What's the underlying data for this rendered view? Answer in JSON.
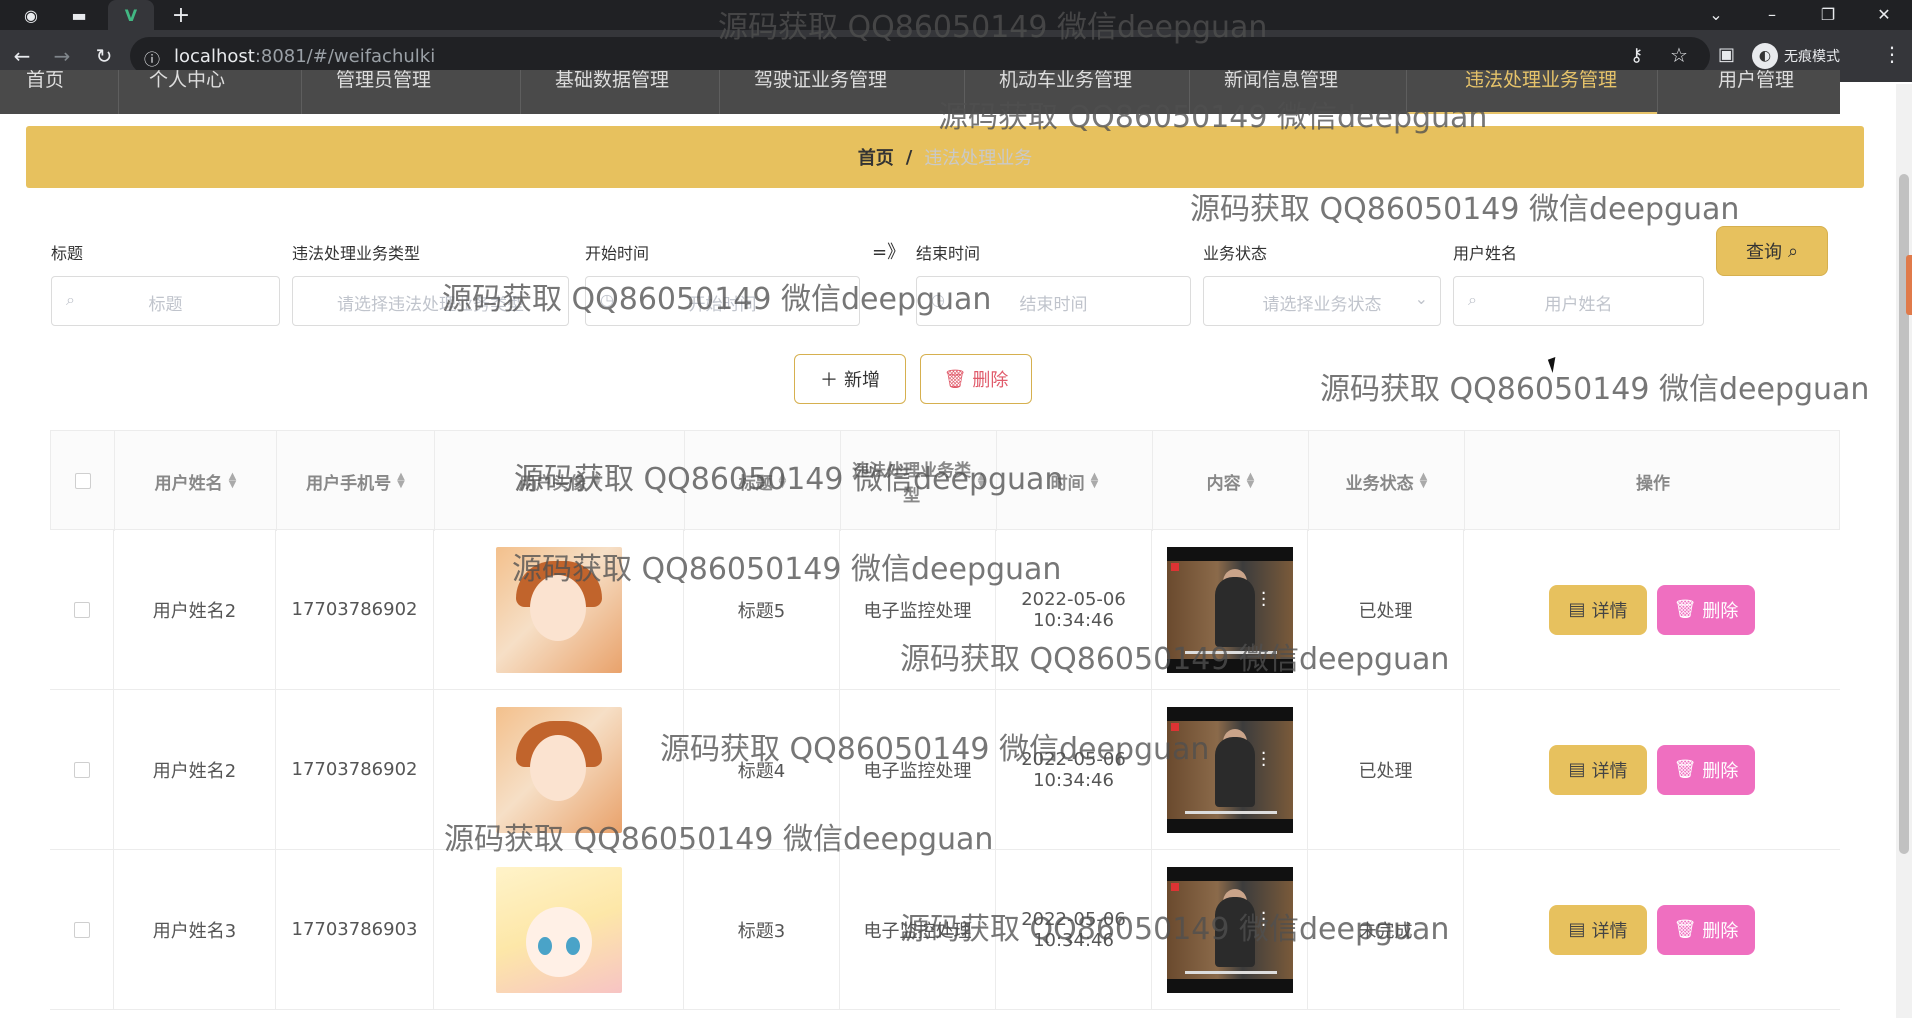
{
  "browser": {
    "url_host": "localhost",
    "url_rest": ":8081/#/weifachulki",
    "incognito_label": "无痕模式"
  },
  "menu": {
    "items": [
      {
        "label": "首页"
      },
      {
        "label": "个人中心"
      },
      {
        "label": "管理员管理"
      },
      {
        "label": "基础数据管理"
      },
      {
        "label": "驾驶证业务管理"
      },
      {
        "label": "机动车业务管理"
      },
      {
        "label": "新闻信息管理"
      },
      {
        "label": "违法处理业务管理"
      },
      {
        "label": "用户管理"
      }
    ]
  },
  "breadcrumb": {
    "home": "首页",
    "separator": "/",
    "current": "违法处理业务"
  },
  "filters": {
    "title_label": "标题",
    "title_placeholder": "标题",
    "type_label": "违法处理业务类型",
    "type_placeholder": "请选择违法处理业务类型",
    "start_label": "开始时间",
    "start_placeholder": "开始时间",
    "range_sep": "=》",
    "end_label": "结束时间",
    "end_placeholder": "结束时间",
    "status_label": "业务状态",
    "status_placeholder": "请选择业务状态",
    "user_label": "用户姓名",
    "user_placeholder": "用户姓名",
    "query_button": "查询"
  },
  "actions": {
    "add": "新增",
    "delete": "删除"
  },
  "table": {
    "columns": [
      "用户姓名",
      "用户手机号",
      "用户头像",
      "标题",
      "违法处理业务类型",
      "时间",
      "内容",
      "业务状态",
      "操作"
    ],
    "rows": [
      {
        "user": "用户姓名2",
        "phone": "17703786902",
        "title": "标题5",
        "type": "电子监控处理",
        "time": "2022-05-06 10:34:46",
        "status": "已处理"
      },
      {
        "user": "用户姓名2",
        "phone": "17703786902",
        "title": "标题4",
        "type": "电子监控处理",
        "time": "2022-05-06 10:34:46",
        "status": "已处理"
      },
      {
        "user": "用户姓名3",
        "phone": "17703786903",
        "title": "标题3",
        "type": "电子监控处理",
        "time": "2022-05-06 10:34:46",
        "status": "未完成"
      }
    ],
    "detail_button": "详情",
    "delete_button": "删除"
  },
  "watermark": "源码获取 QQ86050149 微信deepguan",
  "icons": {
    "search": "search-icon",
    "plus": "plus-icon",
    "trash": "trash-icon",
    "document": "document-icon"
  },
  "colors": {
    "accent": "#e7c15e",
    "danger_button": "#ef6fc0",
    "menu_bg": "#4a4a4a"
  }
}
